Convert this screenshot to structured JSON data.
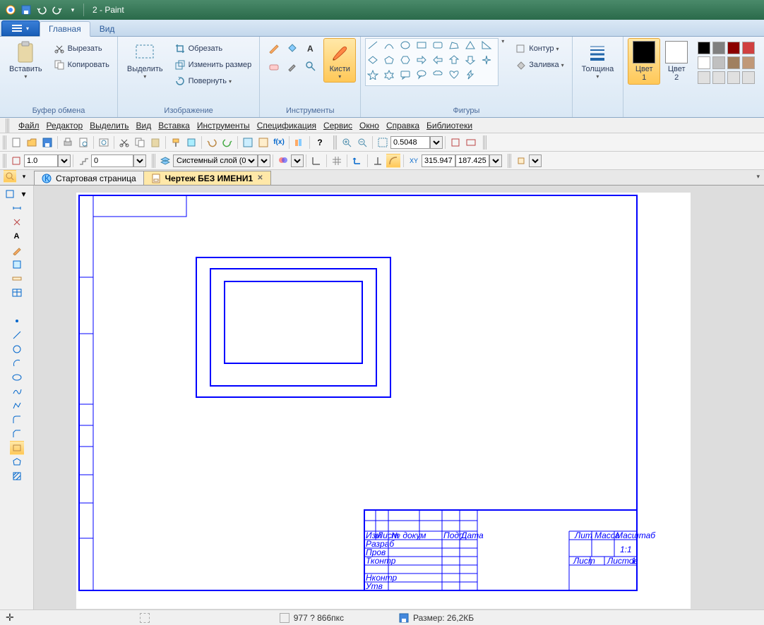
{
  "window": {
    "title": "2 - Paint"
  },
  "ribbon": {
    "file_btn": "",
    "tabs": {
      "home": "Главная",
      "view": "Вид"
    },
    "clipboard": {
      "paste": "Вставить",
      "cut": "Вырезать",
      "copy": "Копировать",
      "group": "Буфер обмена"
    },
    "image": {
      "select": "Выделить",
      "crop": "Обрезать",
      "resize": "Изменить размер",
      "rotate": "Повернуть",
      "group": "Изображение"
    },
    "tools": {
      "brushes": "Кисти",
      "group": "Инструменты"
    },
    "shapes": {
      "outline": "Контур",
      "fill": "Заливка",
      "group": "Фигуры"
    },
    "size": {
      "label": "Толщина"
    },
    "colors": {
      "c1": "Цвет\n1",
      "c2": "Цвет\n2"
    }
  },
  "menubar": [
    "Файл",
    "Редактор",
    "Выделить",
    "Вид",
    "Вставка",
    "Инструменты",
    "Спецификация",
    "Сервис",
    "Окно",
    "Справка",
    "Библиотеки"
  ],
  "tb2": {
    "scale": "1.0",
    "step": "0",
    "layer": "Системный слой (0)"
  },
  "tb1": {
    "zoom_value": "0.5048"
  },
  "tb2b": {
    "coord_x": "315.947",
    "coord_y": "187.425"
  },
  "doctabs": {
    "start": "Стартовая страница",
    "drawing": "Чертеж БЕЗ ИМЕНИ1"
  },
  "titleblock": {
    "rows": [
      "Разраб",
      "Пров",
      "Тконтр",
      "",
      "Нконтр",
      "Утв"
    ],
    "cols_small": [
      "Изм",
      "Лист",
      "№ докум",
      "Подп",
      "Дата"
    ],
    "top_right": [
      "Лит",
      "Масса",
      "Масштаб"
    ],
    "scale_val": "1:1",
    "br": [
      "Лист",
      "",
      "Листов",
      "1"
    ]
  },
  "statusbar": {
    "cursor": "",
    "sel": "",
    "dims": "977 ? 866пкс",
    "size": "Размер: 26,2КБ"
  },
  "colors": {
    "c1": "#000000",
    "c2": "#ffffff",
    "palette": [
      "#000000",
      "#808080",
      "#8b0000",
      "#d04040",
      "#ffffff",
      "#c0c0c0",
      "#a08060",
      "#c09878",
      "#e0e0e0",
      "#e0e0e0",
      "#e0e0e0",
      "#e0e0e0"
    ]
  }
}
